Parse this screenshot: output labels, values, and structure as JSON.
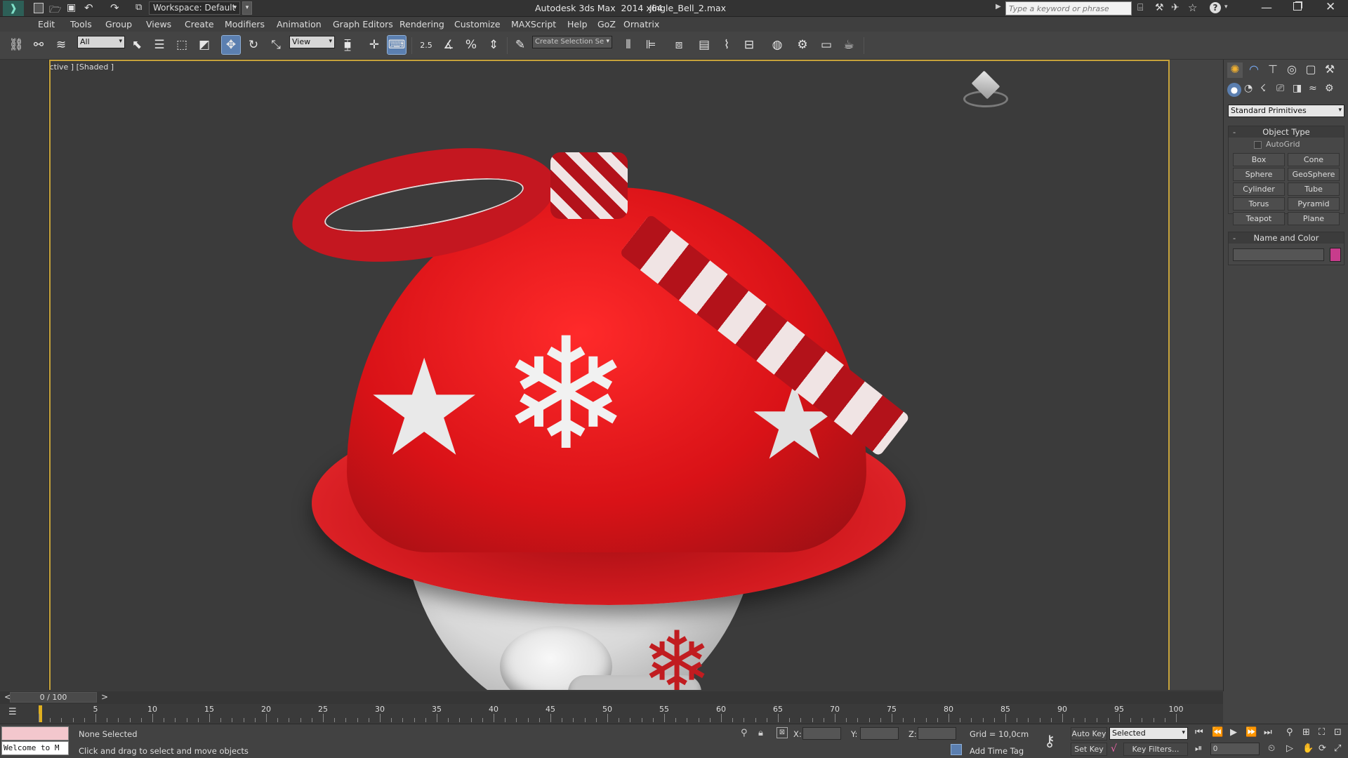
{
  "titlebar": {
    "workspace": "Workspace: Default",
    "app_title": "Autodesk 3ds Max  2014 x64",
    "file_name": "Jingle_Bell_2.max",
    "search_placeholder": "Type a keyword or phrase"
  },
  "menu": [
    "Edit",
    "Tools",
    "Group",
    "Views",
    "Create",
    "Modifiers",
    "Animation",
    "Graph Editors",
    "Rendering",
    "Customize",
    "MAXScript",
    "Help",
    "GoZ",
    "Ornatrix"
  ],
  "toolbar": {
    "filter_value": "All",
    "coord_system": "View",
    "snap_label": "2.5",
    "selection_set_placeholder": "Create Selection Se"
  },
  "viewport": {
    "label": "[+] [Perspective ] [Shaded ]"
  },
  "command_panel": {
    "category": "Standard Primitives",
    "object_type_title": "Object Type",
    "autogrid_label": "AutoGrid",
    "buttons": [
      "Box",
      "Cone",
      "Sphere",
      "GeoSphere",
      "Cylinder",
      "Tube",
      "Torus",
      "Pyramid",
      "Teapot",
      "Plane"
    ],
    "name_color_title": "Name and Color",
    "swatch_color": "#c83c8c"
  },
  "timeline": {
    "frame_counter": "0 / 100",
    "prev": "<",
    "next": ">",
    "tick_labels": [
      "5",
      "10",
      "15",
      "20",
      "25",
      "30",
      "35",
      "40",
      "45",
      "50",
      "55",
      "60",
      "65",
      "70",
      "75",
      "80",
      "85",
      "90",
      "95",
      "100"
    ]
  },
  "status": {
    "selection": "None Selected",
    "prompt": "Click and drag to select and move objects",
    "listener": "Welcome to M",
    "x_label": "X:",
    "y_label": "Y:",
    "z_label": "Z:",
    "grid": "Grid = 10,0cm",
    "add_time_tag": "Add Time Tag",
    "auto_key": "Auto Key",
    "selected_value": "Selected",
    "set_key": "Set Key",
    "key_filters": "Key Filters...",
    "current_frame": "0"
  },
  "colors": {
    "viewport_border": "#c7a33b",
    "active_tool": "#5b7fb0",
    "bell_red": "#c8141a"
  }
}
